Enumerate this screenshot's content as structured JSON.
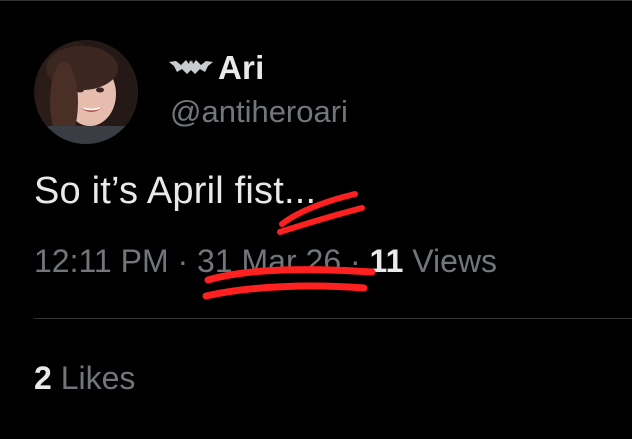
{
  "author": {
    "display_name": "Ari",
    "handle": "@antiheroari",
    "badge_icon": "bat-icon",
    "avatar_icon": "profile-photo"
  },
  "tweet": {
    "text": "So it’s April fist..."
  },
  "meta": {
    "time": "12:11 PM",
    "separator": "·",
    "date": "31 Mar 26",
    "views_count": "11",
    "views_label": "Views"
  },
  "engagement": {
    "likes_count": "2",
    "likes_label": "Likes"
  },
  "colors": {
    "background": "#000000",
    "primary_text": "#e7e9ea",
    "secondary_text": "#71767b",
    "divider": "#2f3336",
    "scribble_red": "#ff2020"
  }
}
